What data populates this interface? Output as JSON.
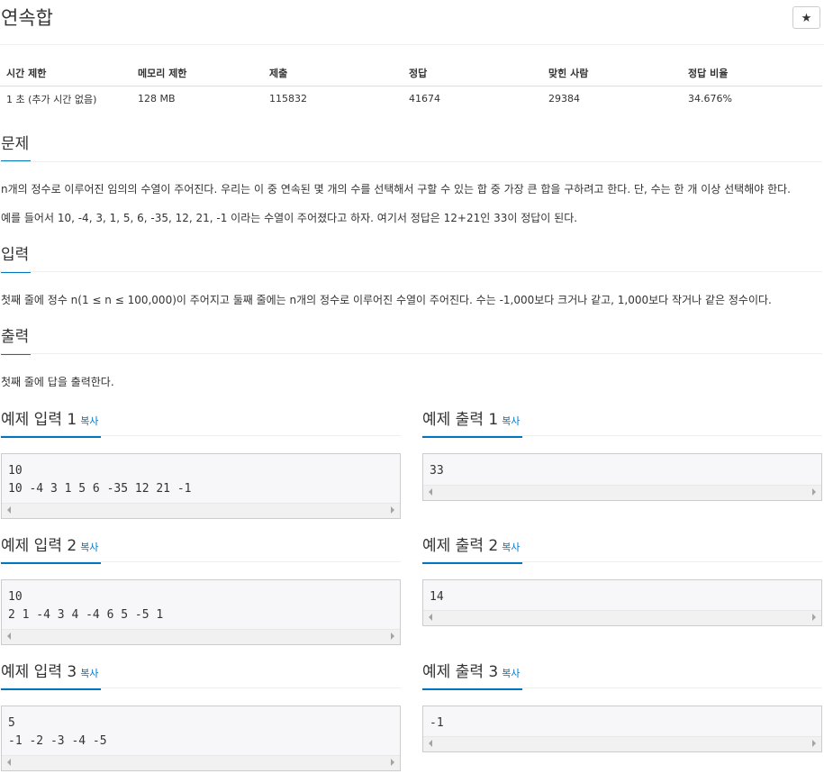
{
  "problem": {
    "title": "연속합",
    "star": "★"
  },
  "info_table": {
    "headers": [
      "시간 제한",
      "메모리 제한",
      "제출",
      "정답",
      "맞힌 사람",
      "정답 비율"
    ],
    "values": [
      "1 초 (추가 시간 없음)",
      "128 MB",
      "115832",
      "41674",
      "29384",
      "34.676%"
    ]
  },
  "sections": {
    "problem_title": "문제",
    "problem_p1": "n개의 정수로 이루어진 임의의 수열이 주어진다. 우리는 이 중 연속된 몇 개의 수를 선택해서 구할 수 있는 합 중 가장 큰 합을 구하려고 한다. 단, 수는 한 개 이상 선택해야 한다.",
    "problem_p2": "예를 들어서 10, -4, 3, 1, 5, 6, -35, 12, 21, -1 이라는 수열이 주어졌다고 하자. 여기서 정답은 12+21인 33이 정답이 된다.",
    "input_title": "입력",
    "input_p": "첫째 줄에 정수 n(1 ≤ n ≤ 100,000)이 주어지고 둘째 줄에는 n개의 정수로 이루어진 수열이 주어진다. 수는 -1,000보다 크거나 같고, 1,000보다 작거나 같은 정수이다.",
    "output_title": "출력",
    "output_p": "첫째 줄에 답을 출력한다."
  },
  "copy_label": "복사",
  "samples": [
    {
      "input_title": "예제 입력 1",
      "input": "10\n10 -4 3 1 5 6 -35 12 21 -1",
      "output_title": "예제 출력 1",
      "output": "33"
    },
    {
      "input_title": "예제 입력 2",
      "input": "10\n2 1 -4 3 4 -4 6 5 -5 1",
      "output_title": "예제 출력 2",
      "output": "14"
    },
    {
      "input_title": "예제 입력 3",
      "input": "5\n-1 -2 -3 -4 -5",
      "output_title": "예제 출력 3",
      "output": "-1"
    }
  ]
}
